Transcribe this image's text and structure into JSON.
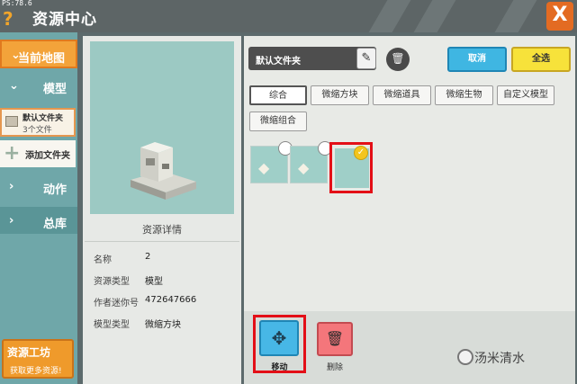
{
  "header": {
    "fps": "PS:78.6",
    "help_icon": "?",
    "title": "资源中心",
    "close_icon": "X"
  },
  "sidebar": {
    "current_map": "当前地图",
    "model": "模型",
    "folder": {
      "name": "默认文件夹",
      "count": "3个文件"
    },
    "add_folder": "添加文件夹",
    "action": "动作",
    "library": "总库",
    "workshop": {
      "title": "资源工坊",
      "subtitle": "获取更多资源!"
    }
  },
  "detail": {
    "title": "资源详情",
    "rows": [
      {
        "label": "名称",
        "value": "2"
      },
      {
        "label": "资源类型",
        "value": "模型"
      },
      {
        "label": "作者迷你号",
        "value": "472647666"
      },
      {
        "label": "模型类型",
        "value": "微缩方块"
      }
    ]
  },
  "folder_bar": {
    "name": "默认文件夹",
    "cancel": "取消",
    "select_all": "全选"
  },
  "tabs": [
    "综合",
    "微缩方块",
    "微缩道具",
    "微缩生物",
    "自定义模型",
    "微缩组合"
  ],
  "bottom": {
    "move": "移动",
    "delete": "删除"
  },
  "watermark": "汤米清水",
  "colors": {
    "accent_orange": "#f3a33a",
    "highlight_red": "#e30f17",
    "cancel_blue": "#3fb6e2",
    "select_yellow": "#f7e23a"
  }
}
